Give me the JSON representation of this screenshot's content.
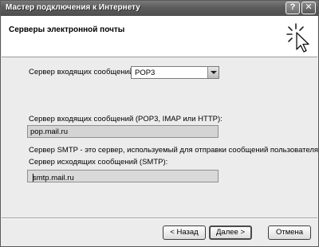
{
  "window": {
    "title": "Мастер подключения к Интернету",
    "help_glyph": "?",
    "close_glyph": "✕"
  },
  "header": {
    "title": "Серверы электронной почты"
  },
  "form": {
    "incoming_type_label": "Сервер входящих сообщений:",
    "incoming_type_value": "POP3",
    "incoming_server_label": "Сервер входящих сообщений (POP3, IMAP или HTTP):",
    "incoming_server_value": "pop.mail.ru",
    "smtp_note": "Сервер SMTP - это сервер, используемый для отправки сообщений  пользователя.",
    "outgoing_server_label": "Сервер исходящих сообщений (SMTP):",
    "outgoing_server_value": "smtp.mail.ru"
  },
  "buttons": {
    "back_prefix": "< ",
    "back_label": "Назад",
    "next_label": "Далее >",
    "cancel_label": "Отмена"
  },
  "icons": {
    "wizard": "cursor-click-icon",
    "dropdown": "chevron-down-icon"
  }
}
